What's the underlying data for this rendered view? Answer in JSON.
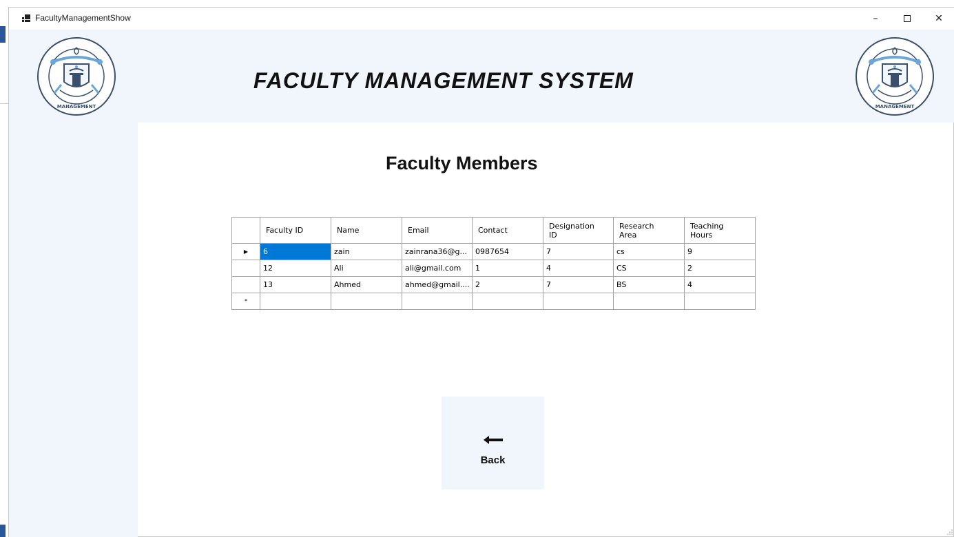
{
  "window": {
    "title": "FacultyManagementShow",
    "minimize_glyph": "–",
    "close_glyph": "✕"
  },
  "header": {
    "app_title": "FACULTY MANAGEMENT SYSTEM",
    "logo_icon": "faculty-management-system-seal-icon"
  },
  "main": {
    "page_title": "Faculty Members",
    "table": {
      "columns": [
        "Faculty ID",
        "Name",
        "Email",
        "Contact",
        "Designation ID",
        "Research Area",
        "Teaching Hours"
      ],
      "column_lines": [
        [
          "Faculty ID"
        ],
        [
          "Name"
        ],
        [
          "Email"
        ],
        [
          "Contact"
        ],
        [
          "Designation",
          "ID"
        ],
        [
          "Research",
          "Area"
        ],
        [
          "Teaching",
          "Hours"
        ]
      ],
      "rows": [
        [
          "6",
          "zain",
          "zainrana36@g...",
          "0987654",
          "7",
          "cs",
          "9"
        ],
        [
          "12",
          "Ali",
          "ali@gmail.com",
          "1",
          "4",
          "CS",
          "2"
        ],
        [
          "13",
          "Ahmed",
          "ahmed@gmail....",
          "2",
          "7",
          "BS",
          "4"
        ]
      ],
      "current_row_glyph": "▶",
      "new_row_glyph": "*"
    },
    "back_button": {
      "label": "Back",
      "icon": "left-arrow-icon"
    }
  },
  "colors": {
    "panel_background": "#f0f6fc",
    "selection": "#0078d7"
  }
}
